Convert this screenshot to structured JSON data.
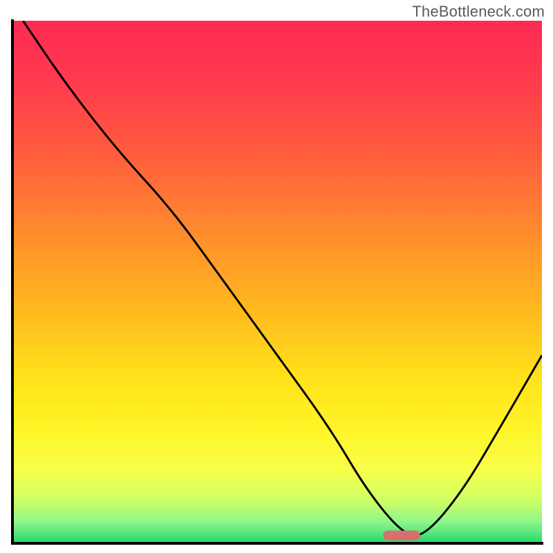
{
  "watermark": "TheBottleneck.com",
  "chart_data": {
    "type": "line",
    "title": "",
    "xlabel": "",
    "ylabel": "",
    "xlim": [
      0,
      100
    ],
    "ylim": [
      0,
      100
    ],
    "grid": false,
    "series": [
      {
        "name": "curve",
        "x": [
          2,
          10,
          20,
          30,
          40,
          50,
          60,
          67,
          74,
          78,
          85,
          92,
          100
        ],
        "y": [
          100,
          88,
          75,
          64,
          50,
          36,
          22,
          10,
          1.5,
          1.5,
          10,
          22,
          36
        ]
      }
    ],
    "marker": {
      "x_range": [
        70,
        77
      ],
      "y": 1.5,
      "color": "#d96e6e"
    },
    "gradient_stops": [
      {
        "offset": 0.0,
        "color": "#ff2a55"
      },
      {
        "offset": 0.12,
        "color": "#ff3b4d"
      },
      {
        "offset": 0.25,
        "color": "#ff5b3e"
      },
      {
        "offset": 0.4,
        "color": "#ff8a2e"
      },
      {
        "offset": 0.55,
        "color": "#ffb81f"
      },
      {
        "offset": 0.68,
        "color": "#ffe11a"
      },
      {
        "offset": 0.78,
        "color": "#fff427"
      },
      {
        "offset": 0.86,
        "color": "#f7ff4a"
      },
      {
        "offset": 0.92,
        "color": "#ccff66"
      },
      {
        "offset": 0.96,
        "color": "#8cf58c"
      },
      {
        "offset": 1.0,
        "color": "#1fd86a"
      }
    ],
    "axis_color": "#000000",
    "line_color": "#000000",
    "line_width": 3
  }
}
